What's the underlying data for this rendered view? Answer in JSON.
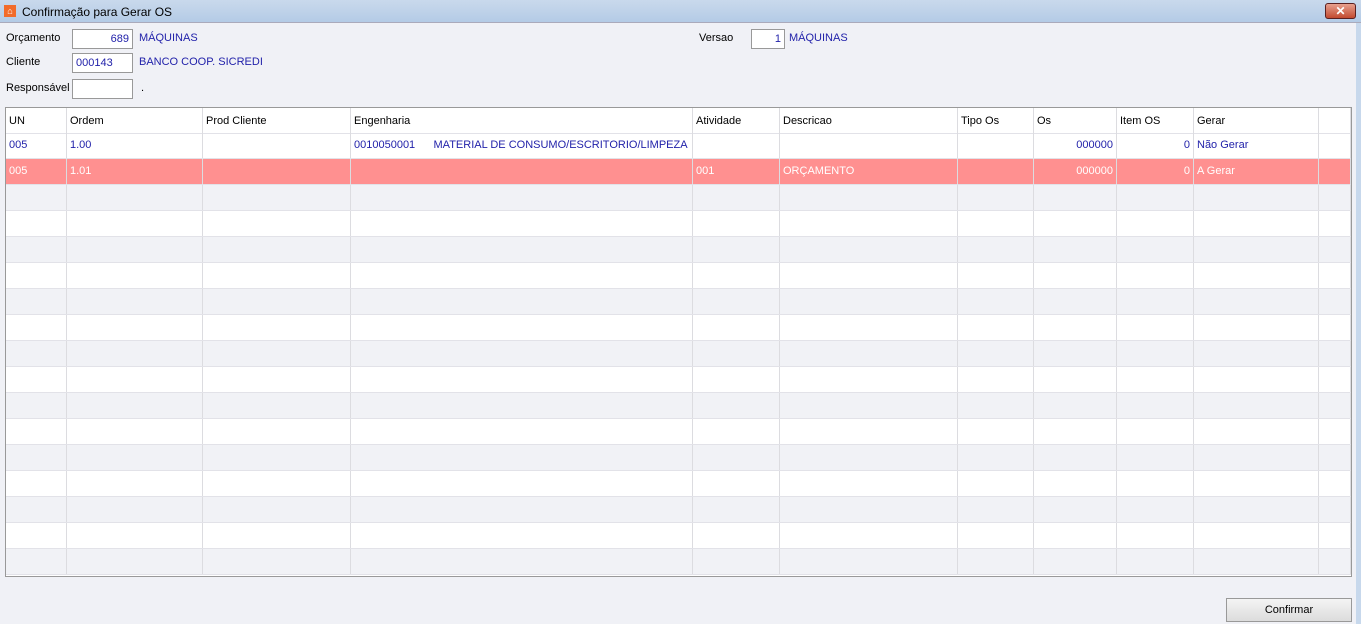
{
  "window": {
    "title": "Confirmação para Gerar OS",
    "close": "✕"
  },
  "form": {
    "orcamento_label": "Orçamento",
    "orcamento_value": "689",
    "orcamento_desc": "MÁQUINAS",
    "versao_label": "Versao",
    "versao_value": "1",
    "versao_desc": "MÁQUINAS",
    "cliente_label": "Cliente",
    "cliente_value": "000143",
    "cliente_desc": "BANCO COOP. SICREDI",
    "responsavel_label": "Responsável",
    "responsavel_value": "",
    "responsavel_desc": "."
  },
  "table": {
    "columns": [
      "UN",
      "Ordem",
      "Prod Cliente",
      "Engenharia",
      "Atividade",
      "Descricao",
      "Tipo Os",
      "Os",
      "Item OS",
      "Gerar"
    ],
    "rows": [
      [
        "005",
        "1.00",
        "",
        "0010050001      MATERIAL DE CONSUMO/ESCRITORIO/LIMPEZA",
        "",
        "",
        "",
        "000000",
        "0",
        "Não Gerar"
      ],
      [
        "005",
        "1.01",
        "",
        "",
        "001",
        "ORÇAMENTO",
        "",
        "000000",
        "0",
        "A Gerar"
      ]
    ],
    "selected_row": 1
  },
  "footer": {
    "confirm": "Confirmar"
  }
}
